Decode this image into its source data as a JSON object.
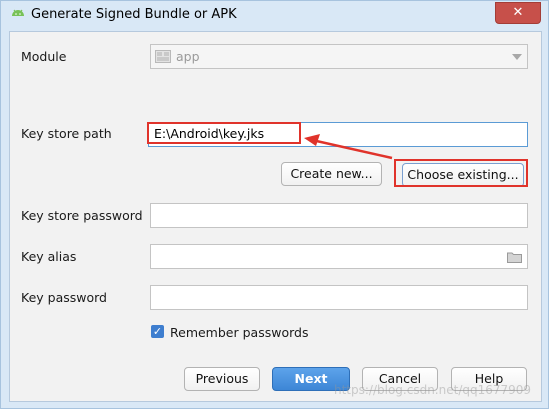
{
  "window": {
    "title": "Generate Signed Bundle or APK",
    "close_symbol": "✕"
  },
  "form": {
    "module": {
      "label": "Module",
      "value": "app"
    },
    "key_store_path": {
      "label": "Key store path",
      "value": "E:\\Android\\key.jks"
    },
    "create_new_label": "Create new...",
    "choose_existing_label": "Choose existing...",
    "key_store_password": {
      "label": "Key store password",
      "value": ""
    },
    "key_alias": {
      "label": "Key alias",
      "value": ""
    },
    "key_password": {
      "label": "Key password",
      "value": ""
    },
    "remember_passwords": {
      "label": "Remember passwords",
      "checked": true
    }
  },
  "footer": {
    "previous_label": "Previous",
    "next_label": "Next",
    "cancel_label": "Cancel",
    "help_label": "Help"
  },
  "watermark": "https://blog.csdn.net/qq1677909",
  "colors": {
    "accent": "#3d86d6",
    "highlight": "#e0332b",
    "title_bg": "#d9e8f6"
  },
  "icons": {
    "app": "android-icon",
    "module": "module-icon",
    "dropdown": "chevron-down-icon",
    "browse": "folder-icon",
    "check": "checkmark-icon"
  }
}
